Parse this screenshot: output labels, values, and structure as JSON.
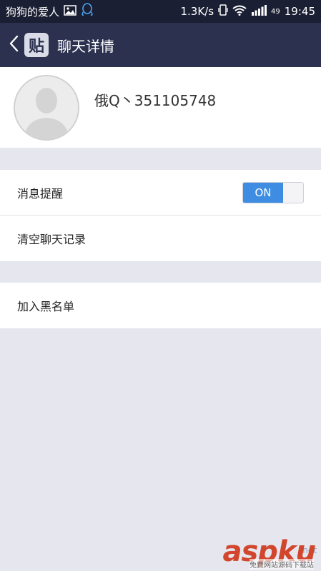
{
  "status_bar": {
    "carrier": "狗狗的爱人",
    "speed": "1.3K/s",
    "signal_num": "49",
    "time": "19:45",
    "icons": [
      "image-icon",
      "qq-icon",
      "vibrate-icon",
      "wifi-icon",
      "signal-icon"
    ]
  },
  "header": {
    "title": "聊天详情",
    "logo_text": "贴",
    "icons": [
      "back-arrow-icon"
    ]
  },
  "profile": {
    "name": "俄Q丶351105748"
  },
  "settings": {
    "message_alert_label": "消息提醒",
    "message_alert_toggle": "ON",
    "clear_history_label": "清空聊天记录",
    "blacklist_label": "加入黑名单"
  },
  "watermark": {
    "brand": "aspku",
    "net": ".net",
    "sub": "免费网站源码下载站"
  }
}
